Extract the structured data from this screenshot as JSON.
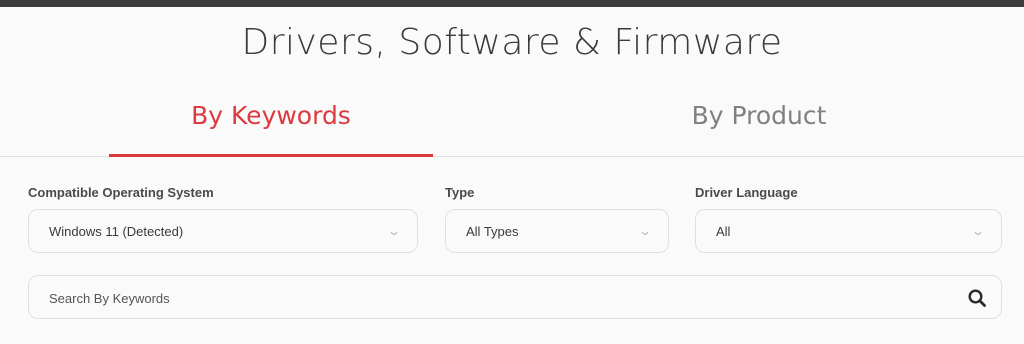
{
  "header": {
    "title": "Drivers, Software & Firmware"
  },
  "tabs": [
    {
      "label": "By Keywords",
      "active": true
    },
    {
      "label": "By Product",
      "active": false
    }
  ],
  "filters": {
    "os": {
      "label": "Compatible Operating System",
      "value": "Windows 11 (Detected)"
    },
    "type": {
      "label": "Type",
      "value": "All Types"
    },
    "language": {
      "label": "Driver Language",
      "value": "All"
    }
  },
  "search": {
    "placeholder": "Search By Keywords",
    "value": ""
  },
  "colors": {
    "accent": "#dc3a3e",
    "top_bar": "#3d3d3d",
    "background": "#fafafa"
  },
  "icons": {
    "dropdown": "chevron-down-icon",
    "search": "search-icon"
  }
}
